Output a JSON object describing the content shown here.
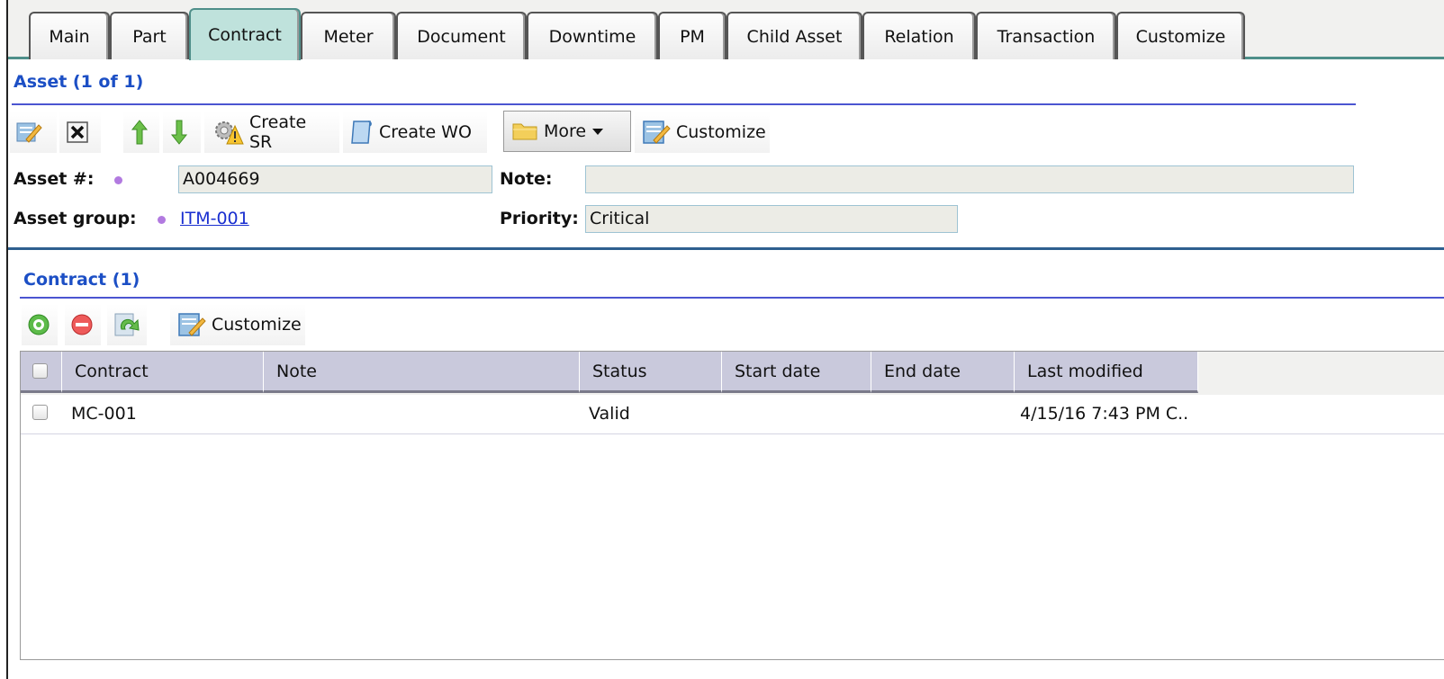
{
  "tabs": [
    "Main",
    "Part",
    "Contract",
    "Meter",
    "Document",
    "Downtime",
    "PM",
    "Child Asset",
    "Relation",
    "Transaction",
    "Customize"
  ],
  "active_tab": "Contract",
  "asset_section": {
    "title": "Asset (1 of 1)",
    "toolbar": {
      "create_sr": "Create SR",
      "create_wo": "Create WO",
      "more": "More",
      "customize": "Customize"
    },
    "fields": {
      "asset_no_label": "Asset #:",
      "asset_no_value": "A004669",
      "note_label": "Note:",
      "note_value": "",
      "asset_group_label": "Asset group:",
      "asset_group_value": "ITM-001",
      "priority_label": "Priority:",
      "priority_value": "Critical"
    }
  },
  "contract_section": {
    "title": "Contract (1)",
    "toolbar": {
      "customize": "Customize"
    },
    "columns": [
      "Contract",
      "Note",
      "Status",
      "Start date",
      "End date",
      "Last modified"
    ],
    "rows": [
      {
        "contract": "MC-001",
        "note": "",
        "status": "Valid",
        "start_date": "",
        "end_date": "",
        "last_modified": "4/15/16 7:43 PM C.."
      }
    ]
  },
  "colors": {
    "section_title": "#1c4fc5",
    "active_tab": "#bfe2dc",
    "link": "#1a2fd0",
    "header_bg": "#c9c9dc",
    "required_dot": "#b27ae0"
  },
  "icons": [
    "edit-icon",
    "close-icon",
    "arrow-up-icon",
    "arrow-down-icon",
    "gear-warning-icon",
    "document-icon",
    "folder-icon",
    "chevron-down-icon",
    "customize-icon",
    "add-icon",
    "remove-icon",
    "refresh-icon"
  ]
}
